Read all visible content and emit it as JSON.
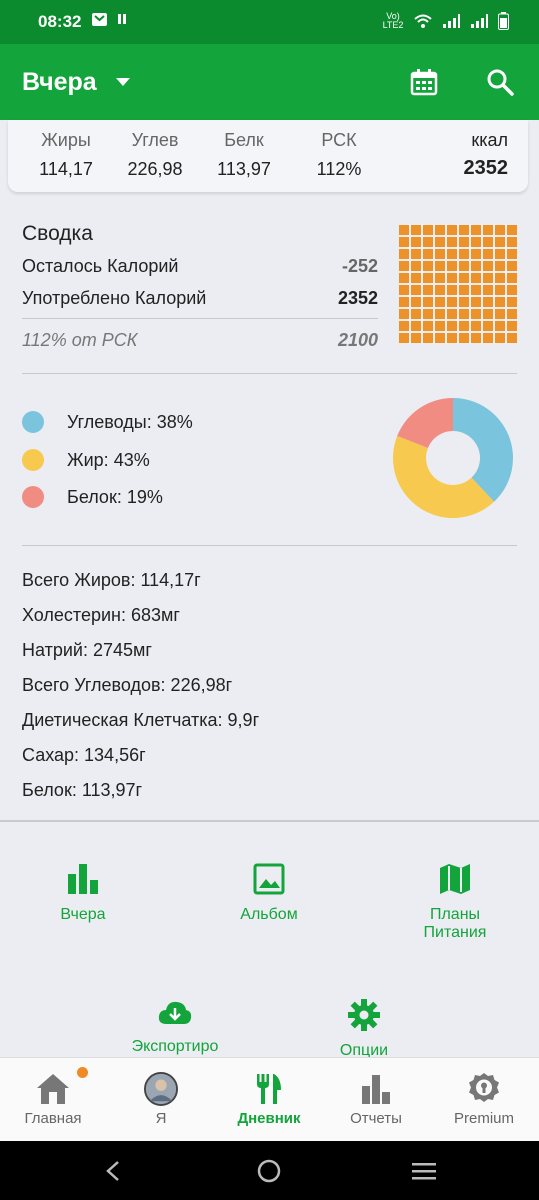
{
  "status_bar": {
    "time": "08:32",
    "net": "Vo) LTE2"
  },
  "app_bar": {
    "title": "Вчера"
  },
  "macros": [
    {
      "label": "Жиры",
      "value": "114,17"
    },
    {
      "label": "Углев",
      "value": "226,98"
    },
    {
      "label": "Белк",
      "value": "113,97"
    },
    {
      "label": "РСК",
      "value": "112%"
    }
  ],
  "kcal": {
    "label": "ккал",
    "value": "2352"
  },
  "summary": {
    "title": "Сводка",
    "remaining_label": "Осталось Калорий",
    "remaining_value": "-252",
    "consumed_label": "Употреблено Калорий",
    "consumed_value": "2352",
    "rsk_label": "112% от РСК",
    "rsk_value": "2100",
    "grid_cells": 100,
    "grid_color": "#ec9228"
  },
  "macro_split": {
    "items": [
      {
        "label": "Углеводы: 38%",
        "percent": 38,
        "color": "#7ac4de"
      },
      {
        "label": "Жир: 43%",
        "percent": 43,
        "color": "#f7c94e"
      },
      {
        "label": "Белок: 19%",
        "percent": 19,
        "color": "#f08c82"
      }
    ]
  },
  "details": [
    "Всего Жиров: 114,17г",
    "Холестерин: 683мг",
    "Натрий: 2745мг",
    "Всего Углеводов: 226,98г",
    "Диетическая Клетчатка: 9,9г",
    "Сахар: 134,56г",
    "Белок: 113,97г"
  ],
  "actions": {
    "yesterday": "Вчера",
    "album": "Альбом",
    "plans_line1": "Планы",
    "plans_line2": "Питания",
    "export": "Экспортиро",
    "options": "Опции"
  },
  "nav": [
    {
      "label": "Главная",
      "icon": "home-icon"
    },
    {
      "label": "Я",
      "icon": "avatar"
    },
    {
      "label": "Дневник",
      "icon": "fork-knife-icon",
      "active": true
    },
    {
      "label": "Отчеты",
      "icon": "bar-chart-icon"
    },
    {
      "label": "Premium",
      "icon": "premium-icon"
    }
  ],
  "colors": {
    "primary": "#13a43b",
    "status_bar": "#0c8a2e",
    "accent": "#f08a24"
  }
}
